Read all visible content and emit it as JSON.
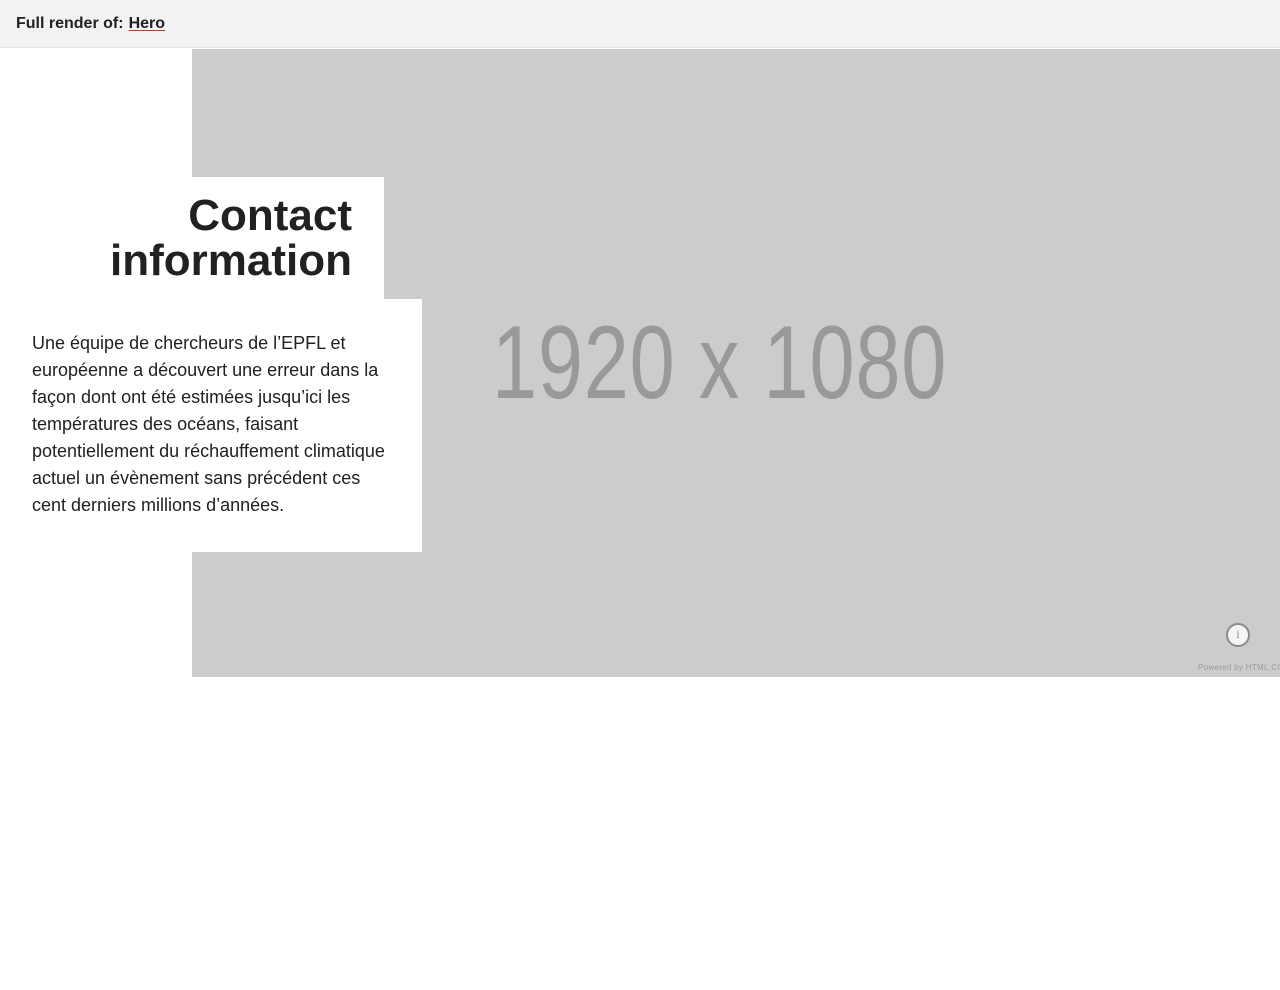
{
  "topbar": {
    "prefix": "Full render of:",
    "link_label": "Hero"
  },
  "hero": {
    "image_placeholder": "1920 x 1080",
    "info_icon": "i",
    "powered_by": "Powered by HTML.CO",
    "title": "Contact information",
    "text": "Une équipe de chercheurs de l’EPFL et européenne a découvert une erreur dans la façon dont ont été estimées jusqu’ici les températures des océans, faisant potentiellement du réchauffement climatique actuel un évènement sans précédent ces cent derniers millions d’années."
  },
  "colors": {
    "placeholder_bg": "#cccccc",
    "placeholder_text": "#999999",
    "link_underline": "#c0392b",
    "text": "#212121"
  },
  "icons": [
    "info-icon"
  ]
}
